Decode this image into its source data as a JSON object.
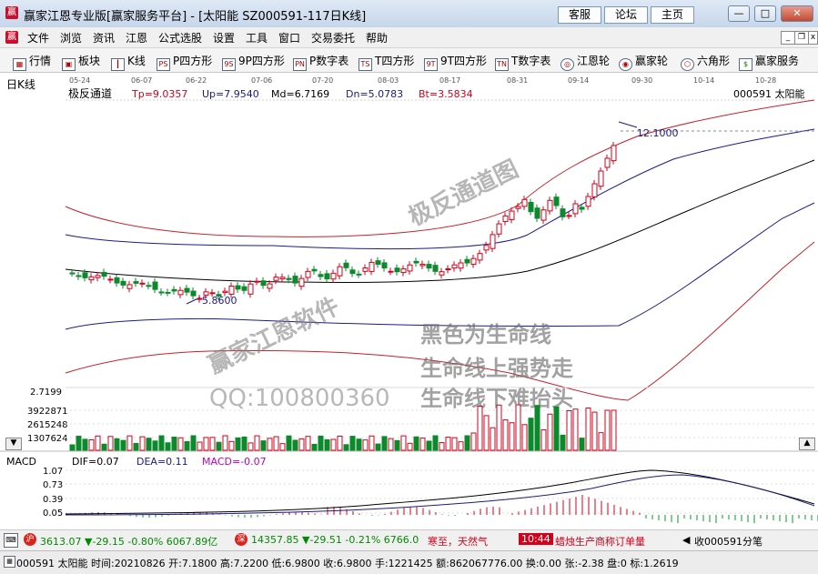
{
  "window": {
    "title": "赢家江恩专业版[赢家服务平台] - [太阳能  SZ000591-117日K线]",
    "buttons": [
      "客服",
      "论坛",
      "主页"
    ],
    "controls": [
      "—",
      "□",
      "✕"
    ]
  },
  "menu": [
    "文件",
    "浏览",
    "资讯",
    "江恩",
    "公式选股",
    "设置",
    "工具",
    "窗口",
    "交易委托",
    "帮助"
  ],
  "toolbar": [
    {
      "label": "行情",
      "icon": "grid-icon",
      "glyph": "▦"
    },
    {
      "label": "板块",
      "icon": "blocks-icon",
      "glyph": "▣"
    },
    {
      "label": "K线",
      "icon": "candlestick-icon",
      "glyph": "┃"
    },
    {
      "label": "P四方形",
      "icon": "p-square-icon",
      "glyph": "PS"
    },
    {
      "label": "9P四方形",
      "icon": "9p-square-icon",
      "glyph": "9S"
    },
    {
      "label": "P数字表",
      "icon": "p-number-icon",
      "glyph": "PN"
    },
    {
      "label": "T四方形",
      "icon": "t-square-icon",
      "glyph": "TS"
    },
    {
      "label": "9T四方形",
      "icon": "9t-square-icon",
      "glyph": "9T"
    },
    {
      "label": "T数字表",
      "icon": "t-number-icon",
      "glyph": "TN"
    },
    {
      "label": "江恩轮",
      "icon": "gann-wheel-icon",
      "glyph": "◎"
    },
    {
      "label": "赢家轮",
      "icon": "winner-wheel-icon",
      "glyph": "◉"
    },
    {
      "label": "六角形",
      "icon": "hexagon-icon",
      "glyph": "⬡"
    },
    {
      "label": "赢家服务",
      "icon": "dollar-icon",
      "glyph": "$"
    }
  ],
  "chart": {
    "period_label": "日K线",
    "dates": [
      "05-24",
      "06-07",
      "06-22",
      "07-06",
      "07-20",
      "08-03",
      "08-17",
      "08-31",
      "09-14",
      "09-30",
      "10-14",
      "10-28"
    ],
    "indicator_name": "极反通道",
    "stats": [
      {
        "label": "Tp=9.0357",
        "color": "#d0021b"
      },
      {
        "label": "Up=7.9540",
        "color": "#1a1a80"
      },
      {
        "label": "Md=6.7169",
        "color": "#000000"
      },
      {
        "label": "Dn=5.0783",
        "color": "#1a1a80"
      },
      {
        "label": "Bt=3.5834",
        "color": "#d0021b"
      }
    ],
    "code_name": "000591  太阳能",
    "high_label": "12.1000",
    "low_label": "5.8600",
    "watermarks": [
      "极反通道图",
      "赢家江恩软件",
      "QQ:100800360"
    ],
    "annotations": [
      "黑色为生命线",
      "生命线上强势走",
      "生命线下难抬头"
    ],
    "volume_axis": [
      "2.7199",
      "3922871",
      "2615248",
      "1307624"
    ],
    "macd": {
      "label": "MACD",
      "dif": "DIF=0.07",
      "dea": "DEA=0.11",
      "macd": "MACD=-0.07",
      "axis": [
        "1.07",
        "0.73",
        "0.39",
        "0.05"
      ]
    }
  },
  "index_bar": {
    "sh_badge": "沪",
    "sh": "3613.07 ▼-29.15 -0.80% 6067.89亿",
    "sz_badge": "深",
    "sz": "14357.85 ▼-29.51 -0.21% 6766.0",
    "ticker_text": "寒至，天然气",
    "time": "10:44",
    "news": "蜡烛生产商称订单量",
    "msg": "收000591分笔"
  },
  "status_bar": "000591 太阳能 时间:20210826 开:7.1800 高:7.2200 低:6.9800 收:6.9800 手:1221425 额:862067776.00 换:0.00 张:-2.38 盘:0 标:1.2619"
}
